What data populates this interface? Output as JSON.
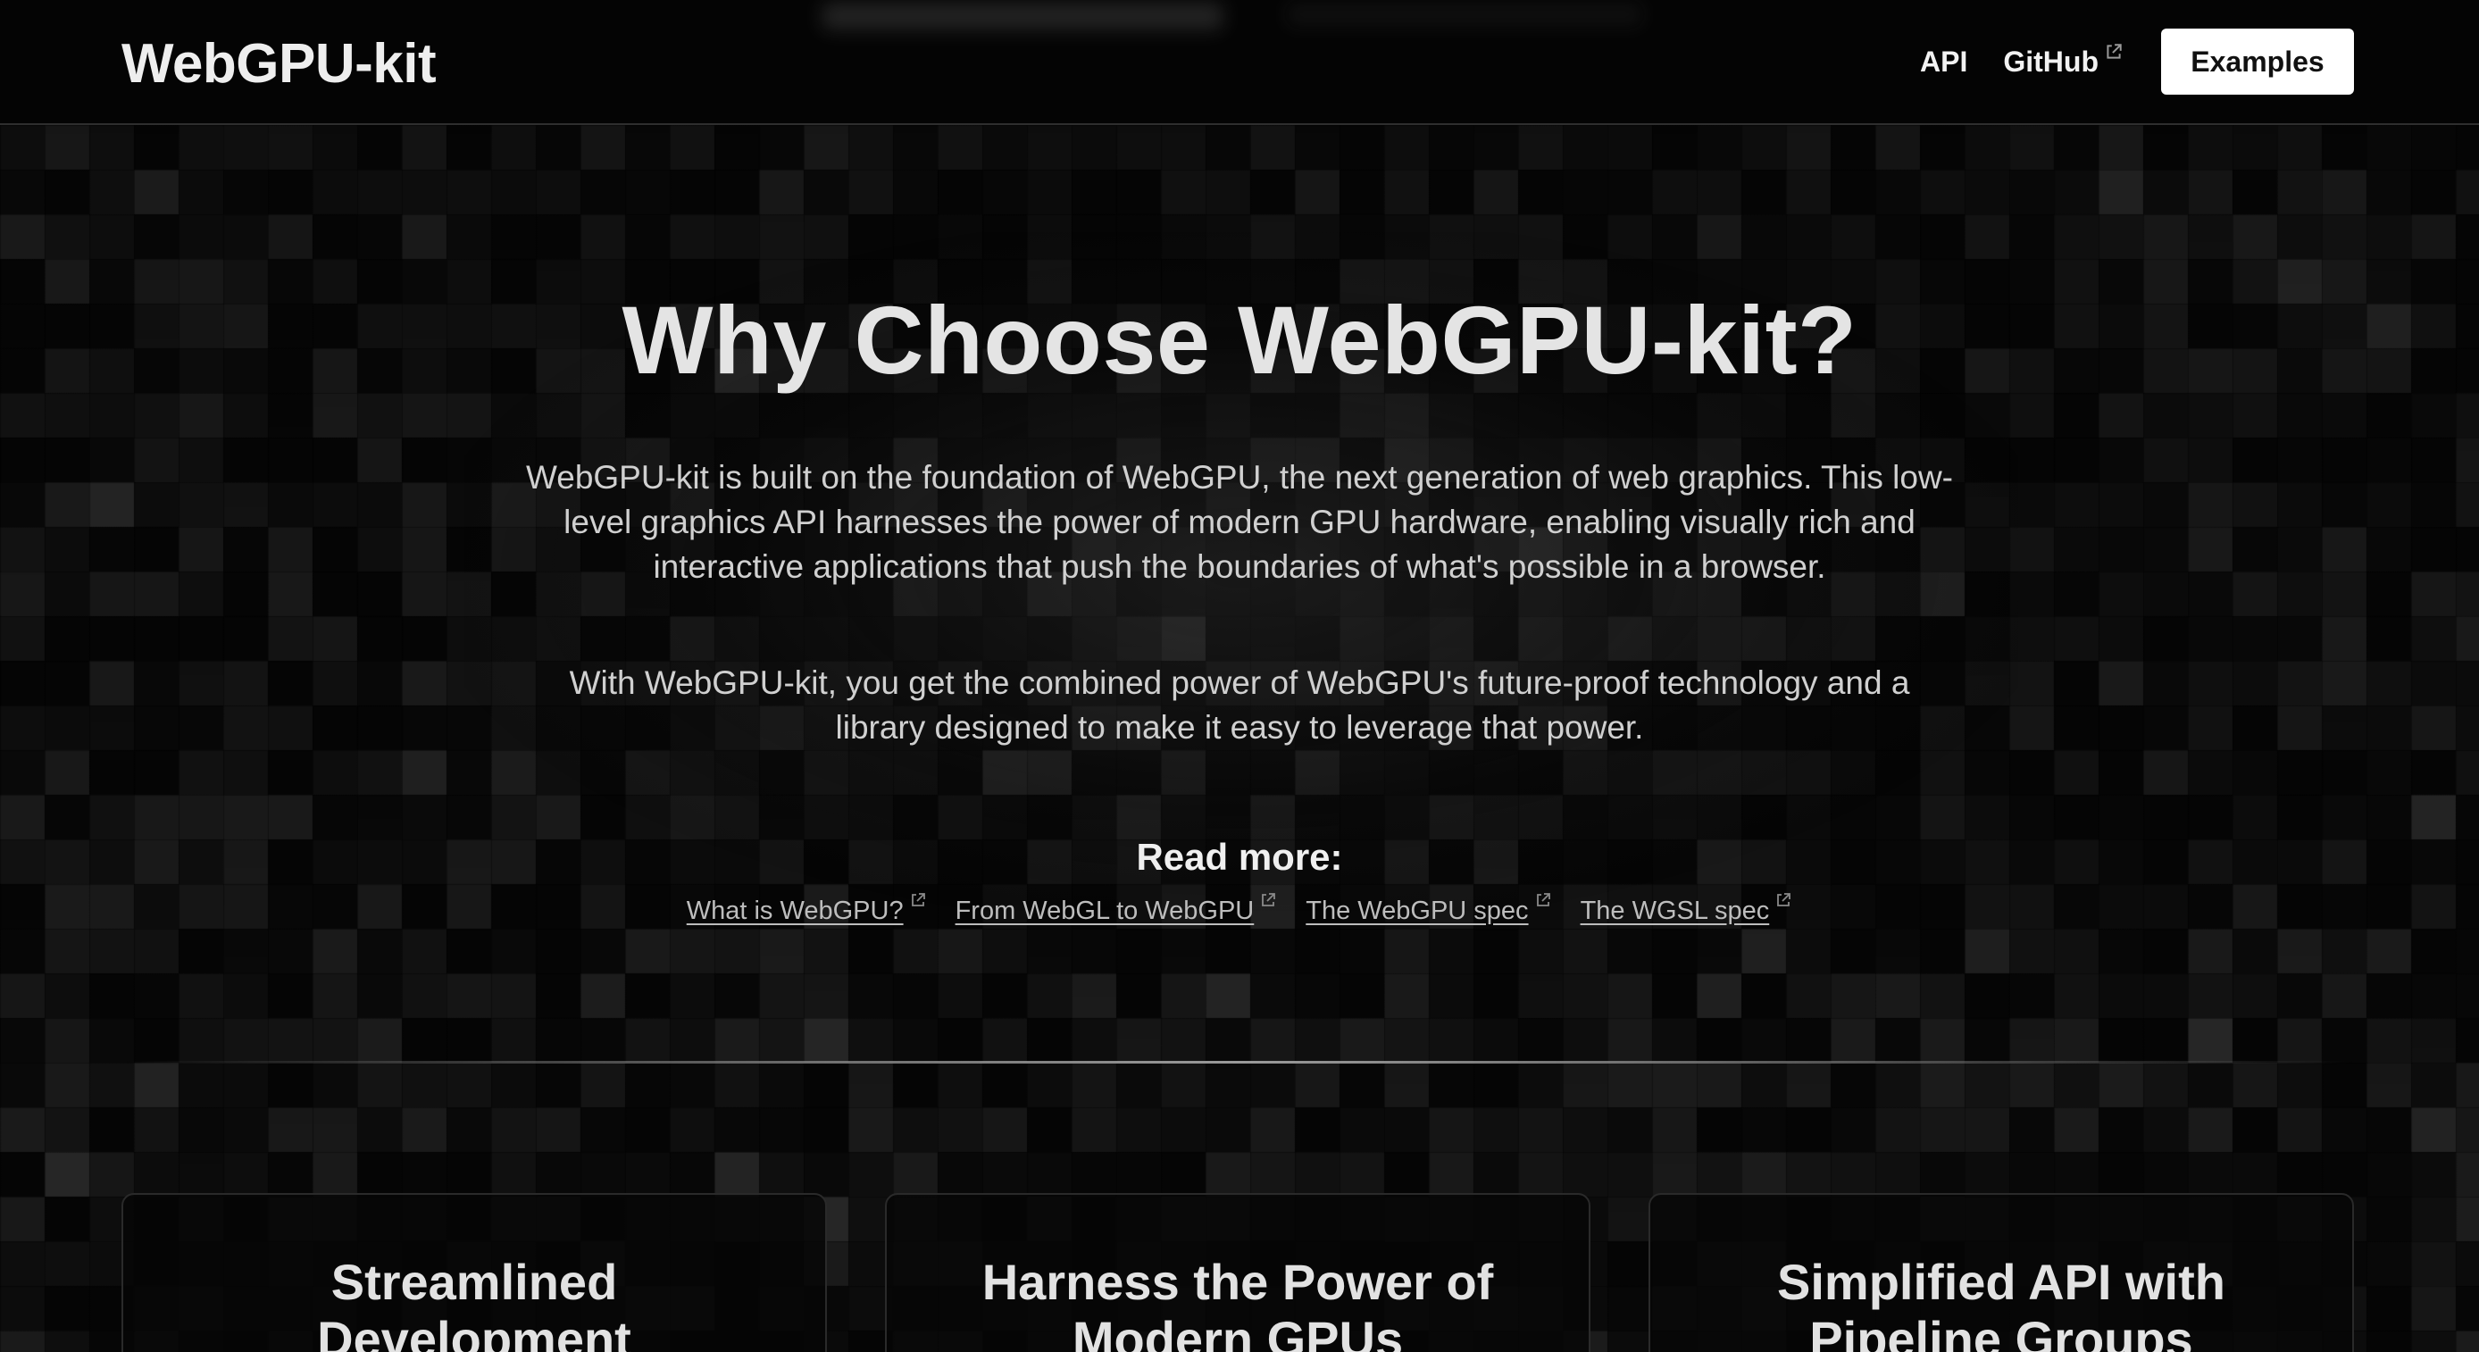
{
  "header": {
    "logo": "WebGPU-kit",
    "nav": {
      "api_label": "API",
      "github_label": "GitHub",
      "examples_label": "Examples"
    }
  },
  "hero": {
    "title": "Why Choose WebGPU-kit?",
    "paragraph_1": "WebGPU-kit is built on the foundation of WebGPU, the next generation of web graphics. This low-level graphics API harnesses the power of modern GPU hardware, enabling visually rich and interactive applications that push the boundaries of what's possible in a browser.",
    "paragraph_2": "With WebGPU-kit, you get the combined power of WebGPU's future-proof technology and a library designed to make it easy to leverage that power.",
    "read_more_heading": "Read more:",
    "read_more_links": [
      {
        "label": "What is WebGPU?"
      },
      {
        "label": "From WebGL to WebGPU"
      },
      {
        "label": "The WebGPU spec"
      },
      {
        "label": "The WGSL spec"
      }
    ]
  },
  "features": {
    "cards": [
      {
        "title": "Streamlined Development"
      },
      {
        "title": "Harness the Power of Modern GPUs"
      },
      {
        "title": "Simplified API with Pipeline Groups"
      }
    ]
  },
  "colors": {
    "background": "#050505",
    "text": "#e8e8e8",
    "button_bg": "#ffffff",
    "button_text": "#111111"
  },
  "icons": {
    "external_link": "external-link-icon"
  }
}
